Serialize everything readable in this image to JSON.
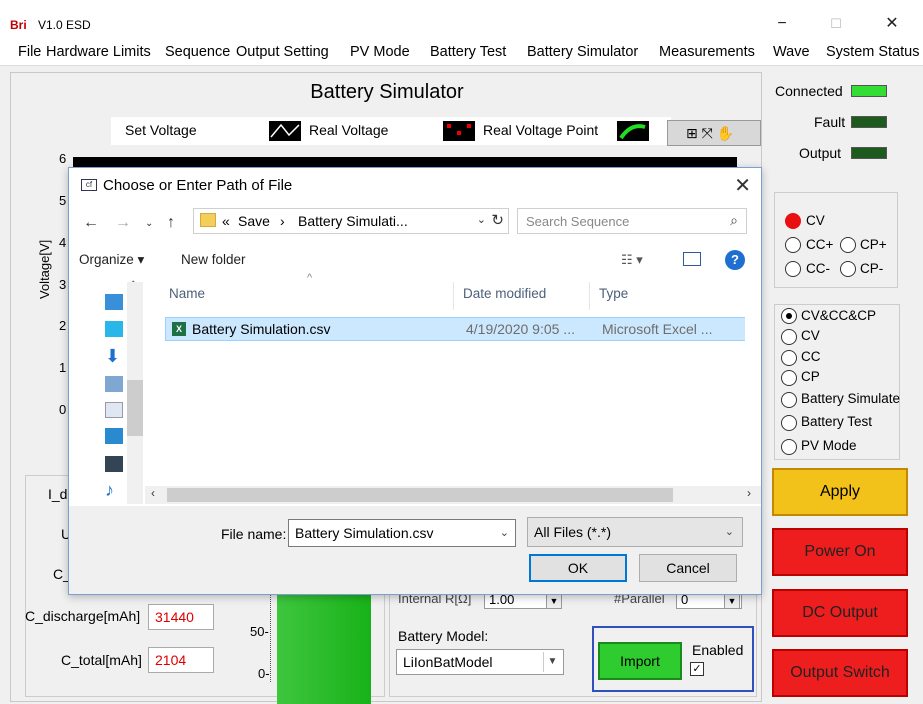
{
  "window": {
    "app_badge": "Bri",
    "title": "V1.0  ESD",
    "minimize": "−",
    "maximize": "☐",
    "close": "✕"
  },
  "menu": [
    "File",
    "Hardware Limits",
    "Sequence",
    "Output Setting",
    "PV Mode",
    "Battery Test",
    "Battery Simulator",
    "Measurements",
    "Wave",
    "System Status"
  ],
  "main": {
    "title": "Battery Simulator",
    "legend": {
      "set_voltage": "Set Voltage",
      "real_voltage": "Real Voltage",
      "real_voltage_point": "Real Voltage Point"
    },
    "plot": {
      "y_ticks": [
        "6",
        "5",
        "4",
        "3",
        "2",
        "1",
        "0"
      ],
      "y_axis_label": "Voltage[V]"
    },
    "bottom": {
      "cut_labels": [
        "I_d",
        "U",
        "C_"
      ],
      "c_discharge_label": "C_discharge[mAh]",
      "c_discharge_value": "31440",
      "c_total_label": "C_total[mAh]",
      "c_total_value": "2104",
      "gauge_ticks": [
        "50-",
        "0-"
      ],
      "internal_r_label": "Internal R[Ω]",
      "internal_r_value": "1.00",
      "parallel_label": "#Parallel",
      "parallel_value": "0",
      "battery_model_label": "Battery Model:",
      "battery_model_value": "LiIonBatModel",
      "import_label": "Import",
      "enabled_label": "Enabled",
      "enabled_checked": true
    }
  },
  "right_panel": {
    "status": [
      {
        "label": "Connected",
        "color": "#33dd33"
      },
      {
        "label": "Fault",
        "color": "#1d5a1d"
      },
      {
        "label": "Output",
        "color": "#1d5a1d"
      }
    ],
    "mode_group_1": [
      "CV",
      "CC+",
      "CP+",
      "CC-",
      "CP-"
    ],
    "mode_group_2": [
      "CV&CC&CP",
      "CV",
      "CC",
      "CP",
      "Battery Simulate",
      "Battery Test",
      "PV Mode"
    ],
    "apply": "Apply",
    "power_on": "Power On",
    "dc_output": "DC Output",
    "output_switch": "Output Switch"
  },
  "dialog": {
    "title": "Choose or Enter Path of File",
    "breadcrumb": [
      "«",
      "Save",
      "›",
      "Battery Simulati..."
    ],
    "search_placeholder": "Search Sequence",
    "organize": "Organize ▾",
    "new_folder": "New folder",
    "columns": {
      "name": "Name",
      "date": "Date modified",
      "type": "Type"
    },
    "files": [
      {
        "name": "Battery Simulation.csv",
        "date": "4/19/2020 9:05 ...",
        "type": "Microsoft Excel ..."
      }
    ],
    "filename_label": "File name:",
    "filename_value": "Battery Simulation.csv",
    "filetype": "All Files (*.*)",
    "ok": "OK",
    "cancel": "Cancel"
  }
}
